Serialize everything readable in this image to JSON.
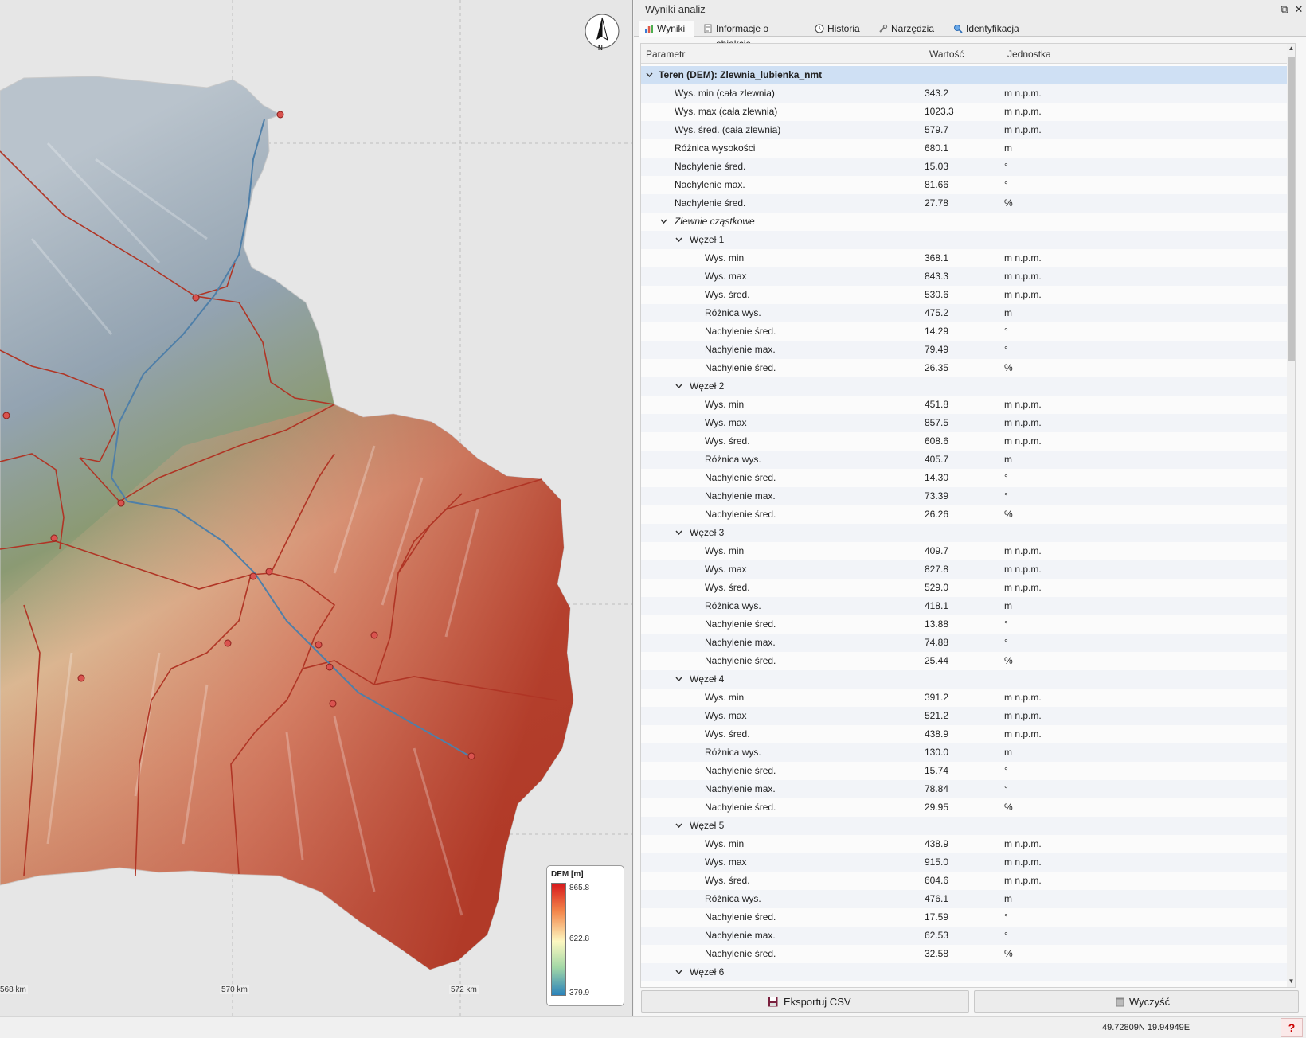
{
  "map": {
    "scale_ticks": [
      "568 km",
      "570 km",
      "572 km"
    ],
    "north_label": "N",
    "legend": {
      "title": "DEM [m]",
      "max": "865.8",
      "mid": "622.8",
      "min": "379.9",
      "colors": [
        "#d7191c",
        "#f3874b",
        "#fdf8c1",
        "#a3d8a6",
        "#2b83ba"
      ]
    }
  },
  "panel": {
    "title": "Wyniki analiz",
    "tabs": [
      {
        "label": "Wyniki",
        "icon": "chart-icon"
      },
      {
        "label": "Informacje o obiekcie",
        "icon": "document-icon"
      },
      {
        "label": "Historia",
        "icon": "clock-icon"
      },
      {
        "label": "Narzędzia",
        "icon": "wrench-icon"
      },
      {
        "label": "Identyfikacja",
        "icon": "magnifier-icon"
      }
    ],
    "columns": {
      "param": "Parametr",
      "value": "Wartość",
      "unit": "Jednostka"
    },
    "root": "Teren (DEM): Zlewnia_lubienka_nmt",
    "main_rows": [
      [
        "Wys. min (cała zlewnia)",
        "343.2",
        "m n.p.m."
      ],
      [
        "Wys. max (cała zlewnia)",
        "1023.3",
        "m n.p.m."
      ],
      [
        "Wys. śred. (cała zlewnia)",
        "579.7",
        "m n.p.m."
      ],
      [
        "Różnica wysokości",
        "680.1",
        "m"
      ],
      [
        "Nachylenie śred.",
        "15.03",
        "°"
      ],
      [
        "Nachylenie max.",
        "81.66",
        "°"
      ],
      [
        "Nachylenie śred.",
        "27.78",
        "%"
      ]
    ],
    "sub_group": "Zlewnie cząstkowe",
    "nodes": [
      {
        "label": "Węzeł 1",
        "rows": [
          [
            "Wys. min",
            "368.1",
            "m n.p.m."
          ],
          [
            "Wys. max",
            "843.3",
            "m n.p.m."
          ],
          [
            "Wys. śred.",
            "530.6",
            "m n.p.m."
          ],
          [
            "Różnica wys.",
            "475.2",
            "m"
          ],
          [
            "Nachylenie śred.",
            "14.29",
            "°"
          ],
          [
            "Nachylenie max.",
            "79.49",
            "°"
          ],
          [
            "Nachylenie śred.",
            "26.35",
            "%"
          ]
        ]
      },
      {
        "label": "Węzeł 2",
        "rows": [
          [
            "Wys. min",
            "451.8",
            "m n.p.m."
          ],
          [
            "Wys. max",
            "857.5",
            "m n.p.m."
          ],
          [
            "Wys. śred.",
            "608.6",
            "m n.p.m."
          ],
          [
            "Różnica wys.",
            "405.7",
            "m"
          ],
          [
            "Nachylenie śred.",
            "14.30",
            "°"
          ],
          [
            "Nachylenie max.",
            "73.39",
            "°"
          ],
          [
            "Nachylenie śred.",
            "26.26",
            "%"
          ]
        ]
      },
      {
        "label": "Węzeł 3",
        "rows": [
          [
            "Wys. min",
            "409.7",
            "m n.p.m."
          ],
          [
            "Wys. max",
            "827.8",
            "m n.p.m."
          ],
          [
            "Wys. śred.",
            "529.0",
            "m n.p.m."
          ],
          [
            "Różnica wys.",
            "418.1",
            "m"
          ],
          [
            "Nachylenie śred.",
            "13.88",
            "°"
          ],
          [
            "Nachylenie max.",
            "74.88",
            "°"
          ],
          [
            "Nachylenie śred.",
            "25.44",
            "%"
          ]
        ]
      },
      {
        "label": "Węzeł 4",
        "rows": [
          [
            "Wys. min",
            "391.2",
            "m n.p.m."
          ],
          [
            "Wys. max",
            "521.2",
            "m n.p.m."
          ],
          [
            "Wys. śred.",
            "438.9",
            "m n.p.m."
          ],
          [
            "Różnica wys.",
            "130.0",
            "m"
          ],
          [
            "Nachylenie śred.",
            "15.74",
            "°"
          ],
          [
            "Nachylenie max.",
            "78.84",
            "°"
          ],
          [
            "Nachylenie śred.",
            "29.95",
            "%"
          ]
        ]
      },
      {
        "label": "Węzeł 5",
        "rows": [
          [
            "Wys. min",
            "438.9",
            "m n.p.m."
          ],
          [
            "Wys. max",
            "915.0",
            "m n.p.m."
          ],
          [
            "Wys. śred.",
            "604.6",
            "m n.p.m."
          ],
          [
            "Różnica wys.",
            "476.1",
            "m"
          ],
          [
            "Nachylenie śred.",
            "17.59",
            "°"
          ],
          [
            "Nachylenie max.",
            "62.53",
            "°"
          ],
          [
            "Nachylenie śred.",
            "32.58",
            "%"
          ]
        ]
      },
      {
        "label": "Węzeł 6",
        "rows": []
      }
    ],
    "buttons": {
      "export": "Eksportuj CSV",
      "clear": "Wyczyść"
    }
  },
  "status": {
    "coords": "49.72809N  19.94949E",
    "help": "?"
  }
}
